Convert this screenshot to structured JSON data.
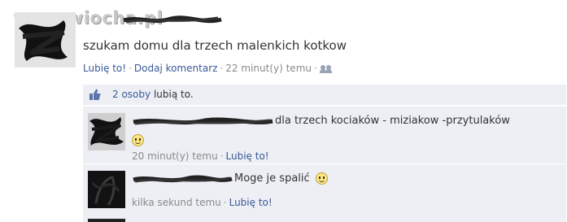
{
  "watermark": "www.wiocha.pl",
  "post": {
    "text": "szukam domu dla trzech malenkich kotkow",
    "like_link": "Lubię to!",
    "comment_link": "Dodaj komentarz",
    "time": "22 minut(y) temu",
    "audience_icon": "friends-icon"
  },
  "likes": {
    "icon": "thumbs-up-icon",
    "count_link": "2 osoby",
    "suffix": "lubią to."
  },
  "comments": [
    {
      "text": "dla trzech kociaków - miziakow -przytulaków",
      "emoticon": "smiley-icon",
      "time": "20 minut(y) temu",
      "like_link": "Lubię to!"
    },
    {
      "text": "Moge je spalić",
      "emoticon": "smiley-icon",
      "time": "kilka sekund temu",
      "like_link": "Lubię to!"
    }
  ],
  "colors": {
    "link": "#3b5998",
    "comment_bg": "#edeff4",
    "meta": "#8a8a8a"
  }
}
